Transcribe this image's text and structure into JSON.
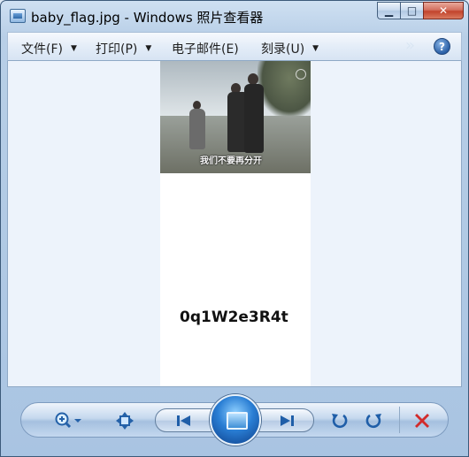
{
  "window": {
    "title": "baby_flag.jpg - Windows 照片查看器",
    "min_glyph": "▁",
    "max_glyph": "□",
    "close_glyph": "✕"
  },
  "menu": {
    "items": [
      {
        "label": "文件(F)",
        "has_dropdown": true
      },
      {
        "label": "打印(P)",
        "has_dropdown": true
      },
      {
        "label": "电子邮件(E)",
        "has_dropdown": false
      },
      {
        "label": "刻录(U)",
        "has_dropdown": true
      }
    ],
    "dropdown_glyph": "▼",
    "more_glyph": "»",
    "help_glyph": "?"
  },
  "image": {
    "caption": "我们不要再分开",
    "hidden_text": "0q1W2e3R4t"
  },
  "controls": {
    "zoom_icon": "zoom-icon",
    "actual_size_icon": "fit-window-icon",
    "prev_glyph": "⏮",
    "next_glyph": "⏭",
    "rotate_ccw_glyph": "↺",
    "rotate_cw_glyph": "↻",
    "delete_glyph": "✕"
  },
  "colors": {
    "delete_red": "#d22b2b",
    "accent_blue": "#2a7ed4"
  }
}
